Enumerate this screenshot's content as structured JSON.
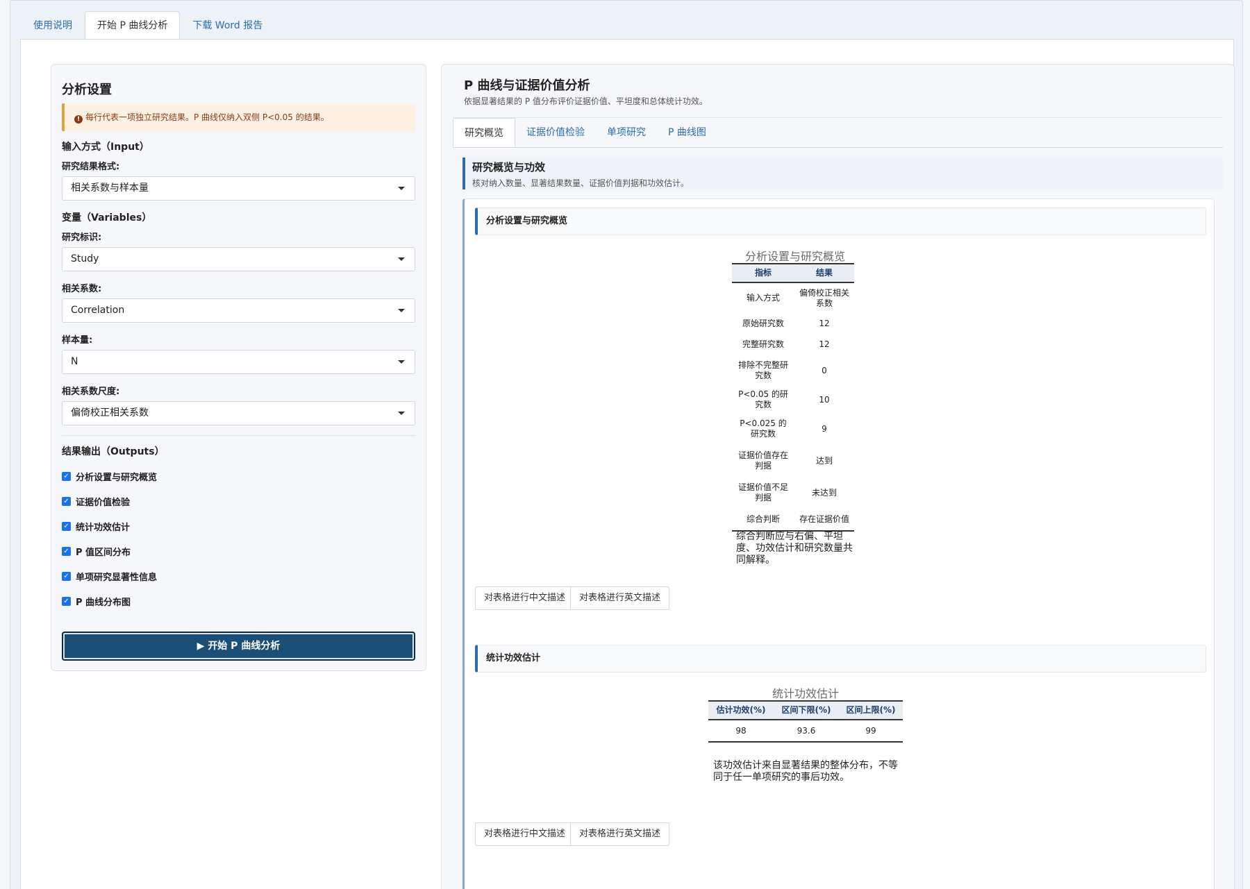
{
  "top_tabs": [
    {
      "label": "使用说明"
    },
    {
      "label": "开始 P 曲线分析"
    },
    {
      "label": "下载 Word 报告"
    }
  ],
  "sidebar": {
    "title": "分析设置",
    "alert": "每行代表一项独立研究结果。P 曲线仅纳入双侧 P<0.05 的结果。",
    "input_section": "输入方式（Input）",
    "format_label": "研究结果格式:",
    "format_value": "相关系数与样本量",
    "variables_section": "变量（Variables）",
    "study_label": "研究标识:",
    "study_value": "Study",
    "corr_label": "相关系数:",
    "corr_value": "Correlation",
    "n_label": "样本量:",
    "n_value": "N",
    "scale_label": "相关系数尺度:",
    "scale_value": "偏倚校正相关系数",
    "outputs_section": "结果输出（Outputs）",
    "outputs": [
      {
        "label": "分析设置与研究概览"
      },
      {
        "label": "证据价值检验"
      },
      {
        "label": "统计功效估计"
      },
      {
        "label": "P 值区间分布"
      },
      {
        "label": "单项研究显著性信息"
      },
      {
        "label": "P 曲线分布图"
      }
    ],
    "run_button": "▶ 开始 P 曲线分析"
  },
  "main": {
    "title": "P 曲线与证据价值分析",
    "subtitle": "依据显著结果的 P 值分布评价证据价值、平坦度和总体统计功效。",
    "tabs": [
      {
        "label": "研究概览"
      },
      {
        "label": "证据价值检验"
      },
      {
        "label": "单项研究"
      },
      {
        "label": "P 曲线图"
      }
    ],
    "overview_title": "研究概览与功效",
    "overview_sub": "核对纳入数量、显著结果数量、证据价值判据和功效估计。",
    "card1": {
      "header": "分析设置与研究概览",
      "caption": "分析设置与研究概览",
      "col1": "指标",
      "col2": "结果",
      "rows": [
        {
          "k": "输入方式",
          "v": "偏倚校正相关系数"
        },
        {
          "k": "原始研究数",
          "v": "12"
        },
        {
          "k": "完整研究数",
          "v": "12"
        },
        {
          "k": "排除不完整研究数",
          "v": "0"
        },
        {
          "k": "P<0.05 的研究数",
          "v": "10"
        },
        {
          "k": "P<0.025 的研究数",
          "v": "9"
        },
        {
          "k": "证据价值存在判据",
          "v": "达到"
        },
        {
          "k": "证据价值不足判据",
          "v": "未达到"
        },
        {
          "k": "综合判断",
          "v": "存在证据价值"
        }
      ],
      "footnote": "综合判断应与右偏、平坦度、功效估计和研究数量共同解释。"
    },
    "card2": {
      "header": "统计功效估计",
      "caption": "统计功效估计",
      "col1": "估计功效(%)",
      "col2": "区间下限(%)",
      "col3": "区间上限(%)",
      "row": {
        "a": "98",
        "b": "93.6",
        "c": "99"
      },
      "footnote": "该功效估计来自显著结果的整体分布，不等同于任一单项研究的事后功效。"
    },
    "btn_cn": "对表格进行中文描述",
    "btn_en": "对表格进行英文描述"
  }
}
